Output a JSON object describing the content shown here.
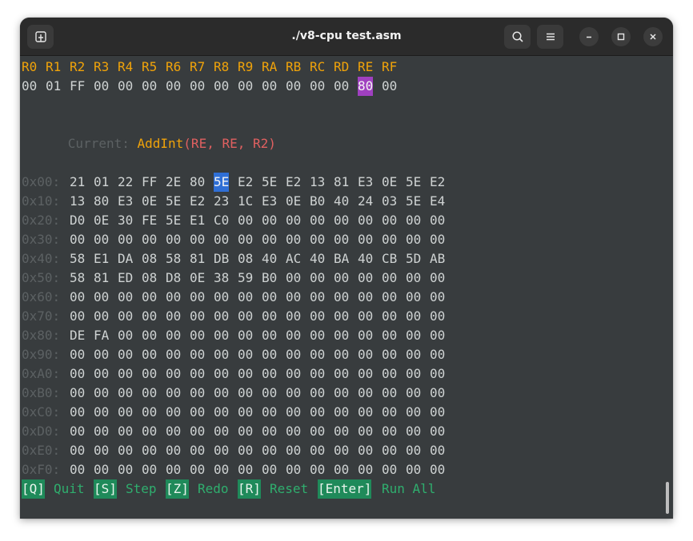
{
  "window": {
    "title": "./v8-cpu test.asm"
  },
  "icons": {
    "new_tab": "new-tab-icon",
    "search": "search-icon",
    "menu": "hamburger-menu-icon",
    "minimize": "minimize-icon",
    "maximize": "maximize-icon",
    "close": "close-icon"
  },
  "registers": {
    "names": [
      "R0",
      "R1",
      "R2",
      "R3",
      "R4",
      "R5",
      "R6",
      "R7",
      "R8",
      "R9",
      "RA",
      "RB",
      "RC",
      "RD",
      "RE",
      "RF"
    ],
    "values": [
      "00",
      "01",
      "FF",
      "00",
      "00",
      "00",
      "00",
      "00",
      "00",
      "00",
      "00",
      "00",
      "00",
      "00",
      "80",
      "00"
    ],
    "highlighted_index": 14
  },
  "current": {
    "label": "Current:",
    "instruction": "AddInt",
    "args": "(RE, RE, R2)"
  },
  "memory": {
    "highlighted_row": 0,
    "highlighted_col": 6,
    "rows": [
      {
        "addr": "0x00:",
        "bytes": [
          "21",
          "01",
          "22",
          "FF",
          "2E",
          "80",
          "5E",
          "E2",
          "5E",
          "E2",
          "13",
          "81",
          "E3",
          "0E",
          "5E",
          "E2"
        ]
      },
      {
        "addr": "0x10:",
        "bytes": [
          "13",
          "80",
          "E3",
          "0E",
          "5E",
          "E2",
          "23",
          "1C",
          "E3",
          "0E",
          "B0",
          "40",
          "24",
          "03",
          "5E",
          "E4"
        ]
      },
      {
        "addr": "0x20:",
        "bytes": [
          "D0",
          "0E",
          "30",
          "FE",
          "5E",
          "E1",
          "C0",
          "00",
          "00",
          "00",
          "00",
          "00",
          "00",
          "00",
          "00",
          "00"
        ]
      },
      {
        "addr": "0x30:",
        "bytes": [
          "00",
          "00",
          "00",
          "00",
          "00",
          "00",
          "00",
          "00",
          "00",
          "00",
          "00",
          "00",
          "00",
          "00",
          "00",
          "00"
        ]
      },
      {
        "addr": "0x40:",
        "bytes": [
          "58",
          "E1",
          "DA",
          "08",
          "58",
          "81",
          "DB",
          "08",
          "40",
          "AC",
          "40",
          "BA",
          "40",
          "CB",
          "5D",
          "AB"
        ]
      },
      {
        "addr": "0x50:",
        "bytes": [
          "58",
          "81",
          "ED",
          "08",
          "D8",
          "0E",
          "38",
          "59",
          "B0",
          "00",
          "00",
          "00",
          "00",
          "00",
          "00",
          "00"
        ]
      },
      {
        "addr": "0x60:",
        "bytes": [
          "00",
          "00",
          "00",
          "00",
          "00",
          "00",
          "00",
          "00",
          "00",
          "00",
          "00",
          "00",
          "00",
          "00",
          "00",
          "00"
        ]
      },
      {
        "addr": "0x70:",
        "bytes": [
          "00",
          "00",
          "00",
          "00",
          "00",
          "00",
          "00",
          "00",
          "00",
          "00",
          "00",
          "00",
          "00",
          "00",
          "00",
          "00"
        ]
      },
      {
        "addr": "0x80:",
        "bytes": [
          "DE",
          "FA",
          "00",
          "00",
          "00",
          "00",
          "00",
          "00",
          "00",
          "00",
          "00",
          "00",
          "00",
          "00",
          "00",
          "00"
        ]
      },
      {
        "addr": "0x90:",
        "bytes": [
          "00",
          "00",
          "00",
          "00",
          "00",
          "00",
          "00",
          "00",
          "00",
          "00",
          "00",
          "00",
          "00",
          "00",
          "00",
          "00"
        ]
      },
      {
        "addr": "0xA0:",
        "bytes": [
          "00",
          "00",
          "00",
          "00",
          "00",
          "00",
          "00",
          "00",
          "00",
          "00",
          "00",
          "00",
          "00",
          "00",
          "00",
          "00"
        ]
      },
      {
        "addr": "0xB0:",
        "bytes": [
          "00",
          "00",
          "00",
          "00",
          "00",
          "00",
          "00",
          "00",
          "00",
          "00",
          "00",
          "00",
          "00",
          "00",
          "00",
          "00"
        ]
      },
      {
        "addr": "0xC0:",
        "bytes": [
          "00",
          "00",
          "00",
          "00",
          "00",
          "00",
          "00",
          "00",
          "00",
          "00",
          "00",
          "00",
          "00",
          "00",
          "00",
          "00"
        ]
      },
      {
        "addr": "0xD0:",
        "bytes": [
          "00",
          "00",
          "00",
          "00",
          "00",
          "00",
          "00",
          "00",
          "00",
          "00",
          "00",
          "00",
          "00",
          "00",
          "00",
          "00"
        ]
      },
      {
        "addr": "0xE0:",
        "bytes": [
          "00",
          "00",
          "00",
          "00",
          "00",
          "00",
          "00",
          "00",
          "00",
          "00",
          "00",
          "00",
          "00",
          "00",
          "00",
          "00"
        ]
      },
      {
        "addr": "0xF0:",
        "bytes": [
          "00",
          "00",
          "00",
          "00",
          "00",
          "00",
          "00",
          "00",
          "00",
          "00",
          "00",
          "00",
          "00",
          "00",
          "00",
          "00"
        ]
      }
    ]
  },
  "shortcuts": [
    {
      "key": "[Q]",
      "label": "Quit"
    },
    {
      "key": "[S]",
      "label": "Step"
    },
    {
      "key": "[Z]",
      "label": "Redo"
    },
    {
      "key": "[R]",
      "label": "Reset"
    },
    {
      "key": "[Enter]",
      "label": "Run All"
    }
  ],
  "colors": {
    "terminal_bg": "#383c3e",
    "register_name": "#f0a30a",
    "instruction": "#f0a30a",
    "args": "#e06060",
    "register_highlight": "#a040c0",
    "memory_highlight": "#2f6fd6",
    "shortcut_key_bg": "#1f8a5a",
    "shortcut_label": "#2fae6e",
    "address": "#5c6163"
  }
}
